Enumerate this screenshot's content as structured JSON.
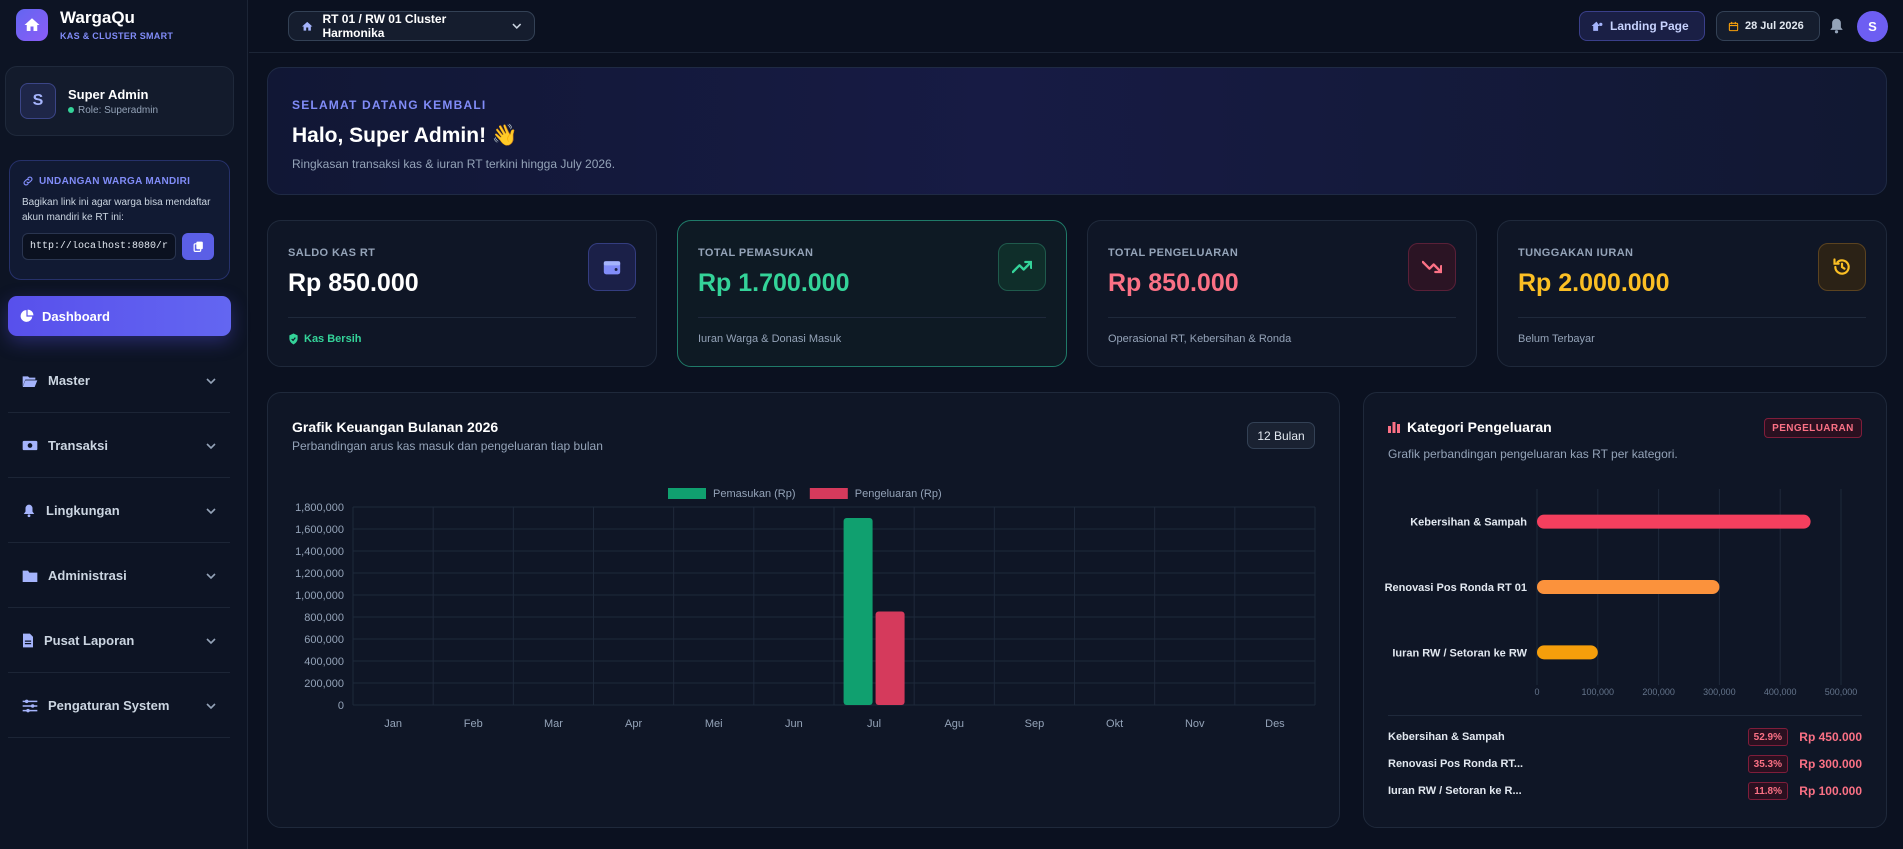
{
  "brand": {
    "title": "WargaQu",
    "subtitle": "KAS & CLUSTER SMART"
  },
  "user": {
    "initial": "S",
    "name": "Super Admin",
    "role": "Role: Superadmin"
  },
  "invite": {
    "title": "UNDANGAN WARGA MANDIRI",
    "text": "Bagikan link ini agar warga bisa mendaftar akun mandiri ke RT ini:",
    "link": "http://localhost:8080/reg"
  },
  "nav": {
    "active": "Dashboard",
    "items": [
      "Master",
      "Transaksi",
      "Lingkungan",
      "Administrasi",
      "Pusat Laporan",
      "Pengaturan System"
    ]
  },
  "topbar": {
    "cluster": "RT 01 / RW 01 Cluster Harmonika",
    "landing": "Landing Page",
    "date": "28 Jul 2026",
    "avatar": "S"
  },
  "welcome": {
    "kicker": "SELAMAT DATANG KEMBALI",
    "title": "Halo, Super Admin! 👋",
    "subtitle": "Ringkasan transaksi kas & iuran RT terkini hingga July 2026."
  },
  "stats": [
    {
      "label": "SALDO KAS RT",
      "value": "Rp 850.000",
      "foot": "Kas Bersih",
      "color": "#ffffff",
      "foot_color": "#34d399",
      "icon": "wallet-icon"
    },
    {
      "label": "TOTAL PEMASUKAN",
      "value": "Rp 1.700.000",
      "foot": "Iuran Warga & Donasi Masuk",
      "color": "#34d399",
      "foot_color": "#94a3b8",
      "icon": "trending-up-icon"
    },
    {
      "label": "TOTAL PENGELUARAN",
      "value": "Rp 850.000",
      "foot": "Operasional RT, Kebersihan & Ronda",
      "color": "#fb7185",
      "foot_color": "#94a3b8",
      "icon": "trending-down-icon"
    },
    {
      "label": "TUNGGAKAN IURAN",
      "value": "Rp 2.000.000",
      "foot": "Belum Terbayar",
      "color": "#fbbf24",
      "foot_color": "#94a3b8",
      "icon": "history-icon"
    }
  ],
  "monthly": {
    "title": "Grafik Keuangan Bulanan 2026",
    "subtitle": "Perbandingan arus kas masuk dan pengeluaran tiap bulan",
    "range": "12 Bulan"
  },
  "categories": {
    "title": "Kategori Pengeluaran",
    "badge": "PENGELUARAN",
    "subtitle": "Grafik perbandingan pengeluaran kas RT per kategori.",
    "rows": [
      {
        "name": "Kebersihan & Sampah",
        "pct": "52.9%",
        "amount": "Rp 450.000"
      },
      {
        "name": "Renovasi Pos Ronda RT...",
        "pct": "35.3%",
        "amount": "Rp 300.000"
      },
      {
        "name": "Iuran RW / Setoran ke R...",
        "pct": "11.8%",
        "amount": "Rp 100.000"
      }
    ]
  },
  "chart_data": [
    {
      "type": "bar",
      "categories": [
        "Jan",
        "Feb",
        "Mar",
        "Apr",
        "Mei",
        "Jun",
        "Jul",
        "Agu",
        "Sep",
        "Okt",
        "Nov",
        "Des"
      ],
      "series": [
        {
          "name": "Pemasukan (Rp)",
          "color": "#10a06f",
          "values": [
            0,
            0,
            0,
            0,
            0,
            0,
            1700000,
            0,
            0,
            0,
            0,
            0
          ]
        },
        {
          "name": "Pengeluaran (Rp)",
          "color": "#d53a5c",
          "values": [
            0,
            0,
            0,
            0,
            0,
            0,
            850000,
            0,
            0,
            0,
            0,
            0
          ]
        }
      ],
      "ylim": [
        0,
        1800000
      ],
      "yticks": [
        "1,800,000",
        "1,600,000",
        "1,400,000",
        "1,200,000",
        "1,000,000",
        "800,000",
        "600,000",
        "400,000",
        "200,000",
        "0"
      ],
      "legend": "top",
      "grid": true
    },
    {
      "type": "bar",
      "orientation": "horizontal",
      "categories": [
        "Kebersihan & Sampah",
        "Renovasi Pos Ronda RT 01",
        "Iuran RW / Setoran ke RW"
      ],
      "values": [
        450000,
        300000,
        100000
      ],
      "colors": [
        "#f43f5e",
        "#fb923c",
        "#f59e0b"
      ],
      "xlim": [
        0,
        500000
      ],
      "xticks": [
        "0",
        "100,000",
        "200,000",
        "300,000",
        "400,000",
        "500,000"
      ],
      "grid": true
    }
  ]
}
